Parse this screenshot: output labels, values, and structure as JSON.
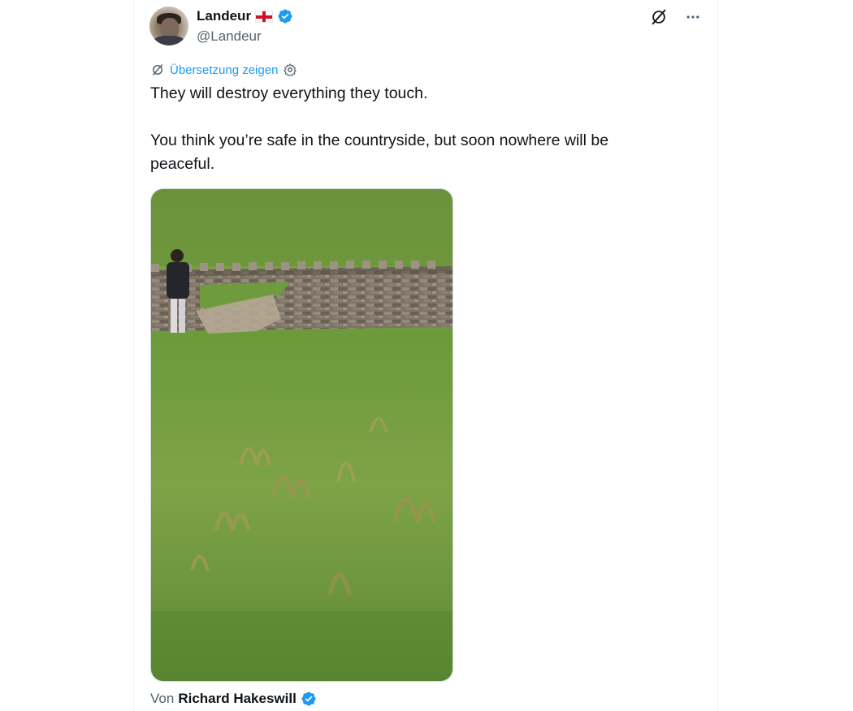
{
  "tweet": {
    "author": {
      "display_name": "Landeur",
      "handle": "@Landeur",
      "flag": "england-flag",
      "verified": true
    },
    "icons": {
      "grok": "grok-icon",
      "more": "more-icon",
      "translate": "translate-icon",
      "settings": "gear-icon",
      "verified": "verified-badge-icon"
    },
    "translate_label": "Übersetzung zeigen",
    "text_paragraphs": [
      "They will destroy everything they touch.",
      "You think you’re safe in the countryside, but soon nowhere will be peaceful."
    ],
    "media": {
      "type": "video",
      "description_icon": "video-thumbnail"
    },
    "attribution": {
      "prefix": "Von",
      "name": "Richard Hakeswill",
      "verified": true
    }
  },
  "colors": {
    "accent": "#1d9bf0",
    "text_primary": "#0f1419",
    "text_secondary": "#536471",
    "border": "#eff3f4"
  }
}
